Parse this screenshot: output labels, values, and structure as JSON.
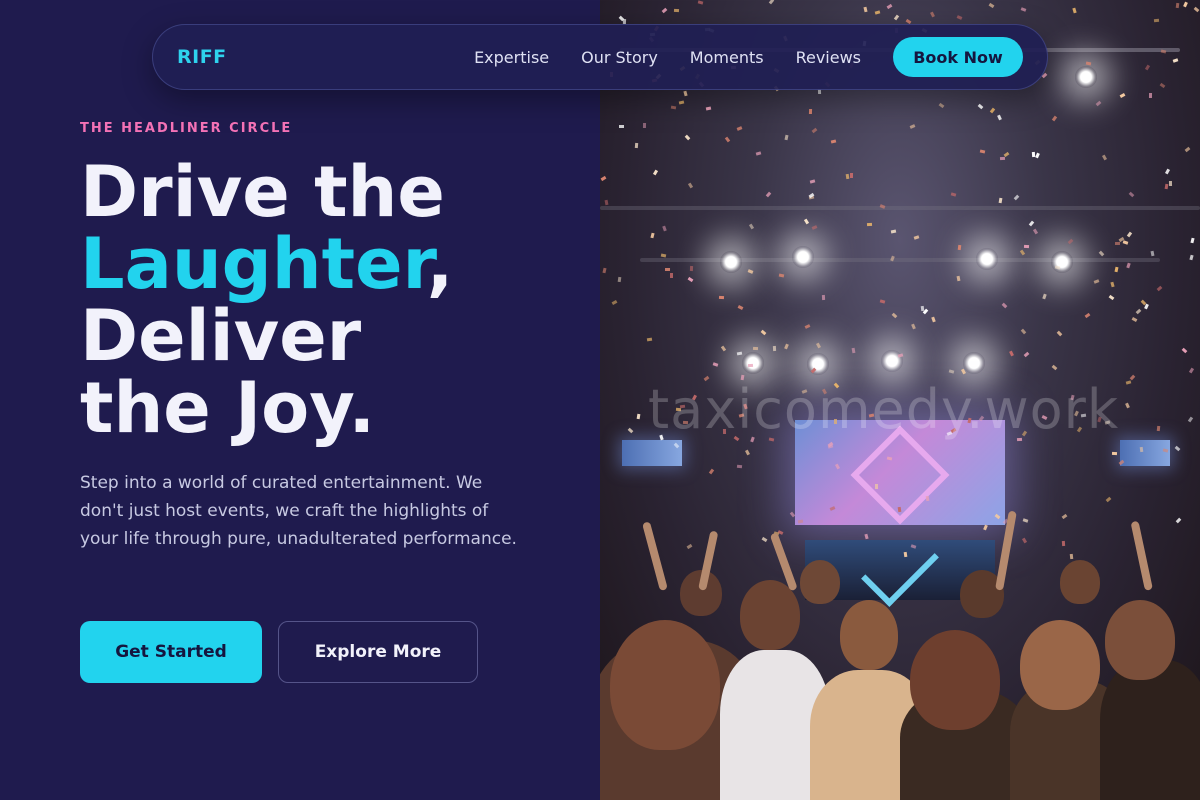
{
  "brand": {
    "name": "RIFF"
  },
  "nav": {
    "links": [
      "Expertise",
      "Our Story",
      "Moments",
      "Reviews"
    ],
    "cta": "Book Now"
  },
  "hero": {
    "eyebrow": "THE HEADLINER CIRCLE",
    "headline_part1": "Drive the",
    "headline_accent": "Laughter",
    "headline_comma": ",",
    "headline_part2": "Deliver",
    "headline_part3": "the Joy.",
    "description": "Step into a world of curated entertainment. We don't just host events, we craft the highlights of your life through pure, unadulterated performance.",
    "primary_cta": "Get Started",
    "secondary_cta": "Explore More"
  },
  "image": {
    "watermark": "taxicomedy.work",
    "subject": "concert-crowd-with-confetti"
  },
  "colors": {
    "background": "#1f1b4e",
    "accent": "#22d3ee",
    "eyebrow": "#f472b6",
    "headline": "#f2f2fb",
    "body_text": "#c7c9e2"
  }
}
